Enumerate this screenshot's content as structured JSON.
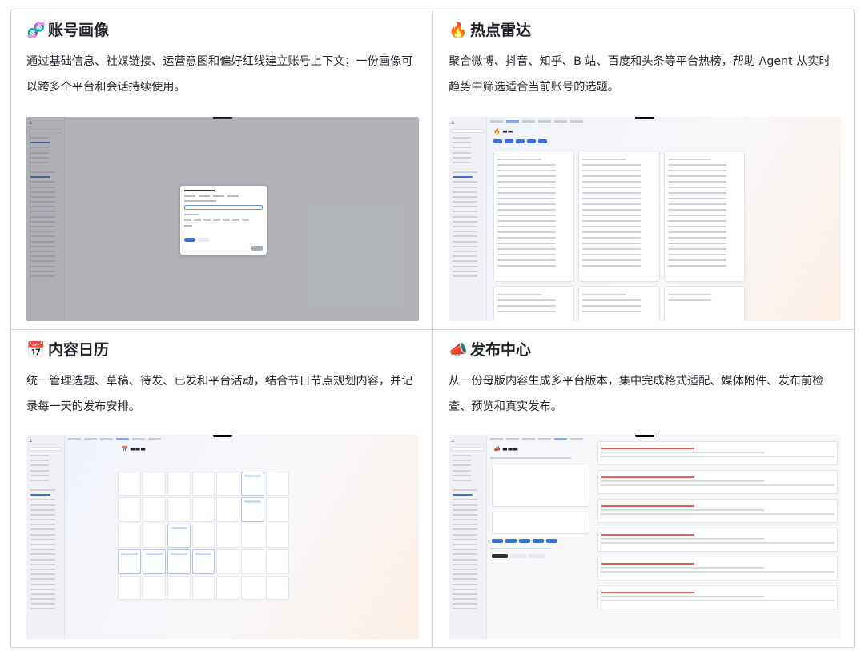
{
  "cards": [
    {
      "title": "账号画像",
      "icon": "🧬",
      "icon_name": "dna-icon",
      "description": "通过基础信息、社媒链接、运营意图和偏好红线建立账号上下文；一份画像可以跨多个平台和会话持续使用。"
    },
    {
      "title": "热点雷达",
      "icon": "🔥",
      "icon_name": "fire-icon",
      "description": "聚合微博、抖音、知乎、B 站、百度和头条等平台热榜，帮助 Agent 从实时趋势中筛选适合当前账号的选题。"
    },
    {
      "title": "内容日历",
      "icon": "📅",
      "icon_name": "calendar-icon",
      "description": "统一管理选题、草稿、待发、已发和平台活动，结合节日节点规划内容，并记录每一天的发布安排。"
    },
    {
      "title": "发布中心",
      "icon": "📣",
      "icon_name": "megaphone-icon",
      "description": "从一份母版内容生成多平台版本，集中完成格式适配、媒体附件、发布前检查、预览和真实发布。"
    }
  ],
  "colors": {
    "accent": "#3a6fd8",
    "border": "#d0d7de"
  }
}
